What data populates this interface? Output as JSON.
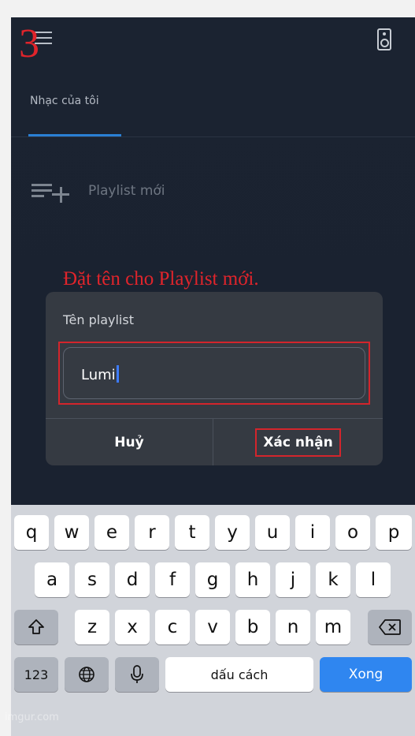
{
  "overlay": {
    "step_number": "3",
    "instruction": "Đặt tên cho Playlist mới.",
    "watermark": "imgur.com"
  },
  "header": {
    "tab_label": "Nhạc của tôi"
  },
  "content": {
    "new_playlist_label": "Playlist mới"
  },
  "dialog": {
    "title": "Tên playlist",
    "input_value": "Lumi",
    "cancel_label": "Huỷ",
    "confirm_label": "Xác nhận"
  },
  "keyboard": {
    "row1": [
      "q",
      "w",
      "e",
      "r",
      "t",
      "y",
      "u",
      "i",
      "o",
      "p"
    ],
    "row2": [
      "a",
      "s",
      "d",
      "f",
      "g",
      "h",
      "j",
      "k",
      "l"
    ],
    "row3": [
      "z",
      "x",
      "c",
      "v",
      "b",
      "n",
      "m"
    ],
    "numbers_label": "123",
    "space_label": "dấu cách",
    "done_label": "Xong"
  },
  "colors": {
    "app_background": "#1b2331",
    "accent_blue": "#2a7fd4",
    "annotation_red": "#e0242b",
    "keyboard_return": "#2f86f0"
  }
}
